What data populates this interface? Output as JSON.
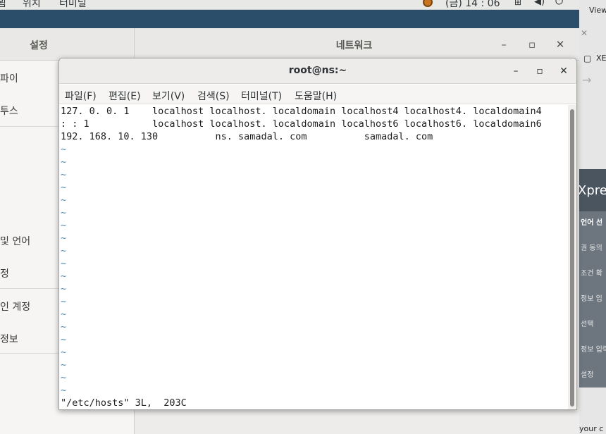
{
  "topbar": {
    "menu1": "뵘",
    "menu2": "위치",
    "menu3": "터미널",
    "clock": "(금) 14 : 06"
  },
  "settings": {
    "title": "설정",
    "panel_title": "네트워크",
    "sidebar_items": [
      "파이",
      "투스",
      "및 언어",
      "정",
      "인 계정",
      "정보"
    ]
  },
  "browser": {
    "view_label": "View",
    "tab_label": "XE",
    "banner_text": "Xpre",
    "menu_items": [
      "언어 선",
      "권 동의",
      "조건 확",
      "정보 입",
      "선택",
      "정보 입력",
      "설정"
    ],
    "bottom_text": "your c"
  },
  "terminal": {
    "title": "root@ns:~",
    "menu": [
      "파일(F)",
      "편집(E)",
      "보기(V)",
      "검색(S)",
      "터미널(T)",
      "도움말(H)"
    ],
    "lines": [
      "127. 0. 0. 1    localhost localhost. localdomain localhost4 localhost4. localdomain4",
      ": : 1           localhost localhost. localdomain localhost6 localhost6. localdomain6",
      "192. 168. 10. 130          ns. samadal. com          samadal. com"
    ],
    "tilde": "~",
    "status": "\"/etc/hosts\" 3L,  203C"
  },
  "colors": {
    "tilde": "#4e89b8",
    "desktop": "#2b4f6b"
  }
}
